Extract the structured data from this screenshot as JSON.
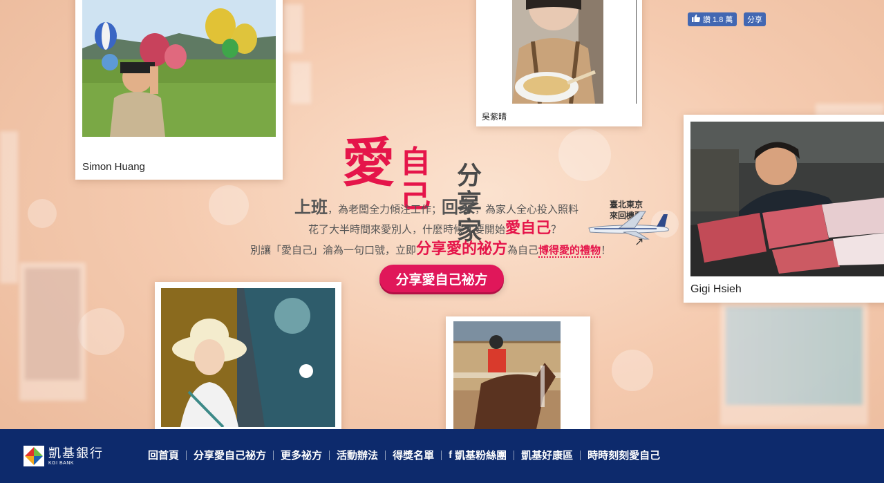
{
  "facebook": {
    "like_count": "讚 1.8 萬",
    "share_label": "分享"
  },
  "headline": {
    "love": "愛",
    "self": "自己",
    "sharer": "分享家"
  },
  "copy": {
    "line1": {
      "a": "上班",
      "b": "，為老闆全力傾注工作；",
      "c": "回家",
      "d": "，為家人全心投入照料"
    },
    "line2": {
      "a": "花了大半時間來愛別人，什麼時候才要開始",
      "b": "愛自己",
      "c": "？"
    },
    "line3": {
      "a": "別讓「愛自己」淪為一句口號，立即",
      "b": "分享愛的祕方",
      "c": "為自己",
      "d": "博得愛的禮物",
      "e": "！"
    }
  },
  "prize": {
    "line1": "臺北東京",
    "line2": "來回機票"
  },
  "cta_label": "分享愛自己祕方",
  "photos": [
    {
      "caption": "Simon Huang"
    },
    {
      "caption": "吳紫晴"
    },
    {
      "caption": "Gigi Hsieh"
    },
    {
      "caption": ""
    },
    {
      "caption": ""
    }
  ],
  "footer": {
    "logo_name": "凱基銀行",
    "logo_sub": "KGI BANK",
    "nav": [
      "回首頁",
      "分享愛自己祕方",
      "更多祕方",
      "活動辦法",
      "得獎名單",
      "凱基粉絲團",
      "凱基好康區",
      "時時刻刻愛自己"
    ]
  },
  "colors": {
    "accent": "#e5154a",
    "footer_bg": "#0d2a6c",
    "facebook": "#4267b2"
  }
}
